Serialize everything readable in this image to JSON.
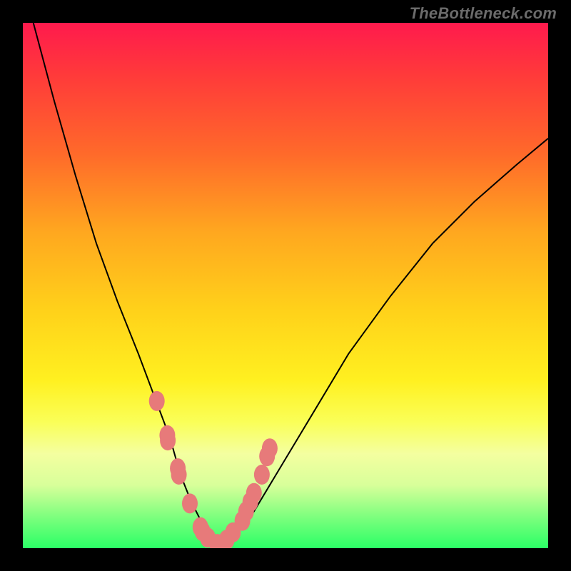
{
  "watermark_text": "TheBottleneck.com",
  "chart_data": {
    "type": "line",
    "title": "",
    "xlabel": "",
    "ylabel": "",
    "xlim": [
      0,
      100
    ],
    "ylim": [
      0,
      100
    ],
    "series": [
      {
        "name": "curve",
        "x": [
          2,
          6,
          10,
          14,
          18,
          22,
          25,
          28,
          30,
          32,
          34,
          36,
          38,
          40,
          44,
          50,
          56,
          62,
          70,
          78,
          86,
          94,
          100
        ],
        "y": [
          100,
          85,
          71,
          58,
          47,
          37,
          29,
          21,
          14,
          9,
          5,
          2,
          1,
          2,
          7,
          17,
          27,
          37,
          48,
          58,
          66,
          73,
          78
        ]
      }
    ],
    "markers": {
      "name": "highlight-dots",
      "x": [
        25.5,
        27.5,
        27.6,
        29.5,
        29.7,
        31.8,
        33.8,
        34.2,
        35.2,
        37.0,
        38.8,
        40.0,
        41.8,
        42.5,
        43.3,
        44.0,
        45.5,
        46.5,
        47.0
      ],
      "y": [
        28.0,
        21.5,
        20.5,
        15.2,
        14.0,
        8.5,
        4.0,
        3.2,
        2.0,
        0.8,
        1.6,
        3.0,
        5.2,
        7.0,
        8.8,
        10.5,
        14.0,
        17.5,
        19.0
      ]
    },
    "gradient_stops": [
      {
        "pos": 0,
        "color": "#ff1a4d"
      },
      {
        "pos": 25,
        "color": "#ff6a2a"
      },
      {
        "pos": 55,
        "color": "#ffd21a"
      },
      {
        "pos": 82,
        "color": "#f4ffa0"
      },
      {
        "pos": 100,
        "color": "#2bff66"
      }
    ]
  }
}
